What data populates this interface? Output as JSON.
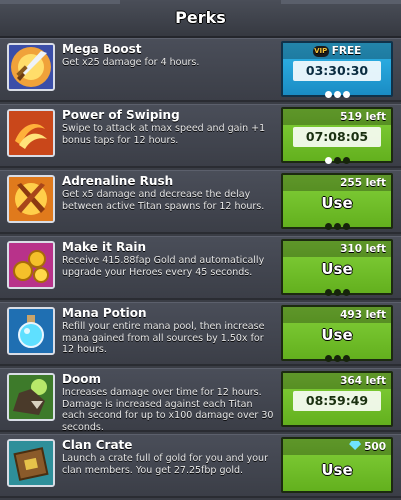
{
  "header": {
    "title": "Perks"
  },
  "perks": [
    {
      "name": "Mega Boost",
      "description": "Get x25 damage for 4 hours.",
      "icon": "sword-icon",
      "button": {
        "style": "blue",
        "top": "FREE",
        "top_badge": "VIP",
        "main": "03:30:30",
        "kind": "timer",
        "dots_filled": 3
      }
    },
    {
      "name": "Power of Swiping",
      "description": "Swipe to attack at max speed and gain +1 bonus taps for 12 hours.",
      "icon": "swipe-icon",
      "button": {
        "style": "green",
        "top": "519 left",
        "main": "07:08:05",
        "kind": "timer",
        "dots_filled": 1
      }
    },
    {
      "name": "Adrenaline Rush",
      "description": "Get x5 damage and decrease the delay between active Titan spawns for 12 hours.",
      "icon": "crossed-swords-icon",
      "button": {
        "style": "green",
        "top": "255 left",
        "main": "Use",
        "kind": "use",
        "dots_filled": 0
      }
    },
    {
      "name": "Make it Rain",
      "description": "Receive 415.88fap Gold and automatically upgrade your Heroes every 45 seconds.",
      "icon": "gold-coins-icon",
      "button": {
        "style": "green",
        "top": "310 left",
        "main": "Use",
        "kind": "use",
        "dots_filled": 0
      }
    },
    {
      "name": "Mana Potion",
      "description": "Refill your entire mana pool, then increase mana gained from all sources by 1.50x for 12 hours.",
      "icon": "potion-icon",
      "button": {
        "style": "green",
        "top": "493 left",
        "main": "Use",
        "kind": "use",
        "dots_filled": 0
      }
    },
    {
      "name": "Doom",
      "description": "Increases damage over time for 12 hours. Damage is increased against each Titan each second for up to x100 damage over 30 seconds.",
      "icon": "beast-icon",
      "button": {
        "style": "green",
        "top": "364 left",
        "main": "08:59:49",
        "kind": "timer",
        "dots_filled": 0
      }
    },
    {
      "name": "Clan Crate",
      "description": "Launch a crate full of gold for you and your clan members. You get 27.25fbp gold.",
      "icon": "crate-icon",
      "button": {
        "style": "green",
        "top": "500",
        "top_badge": "gem",
        "main": "Use",
        "kind": "use",
        "dots_filled": null
      }
    }
  ],
  "colors": {
    "green": "#6fbf28",
    "blue": "#2aa6dc",
    "panel": "#434650"
  }
}
